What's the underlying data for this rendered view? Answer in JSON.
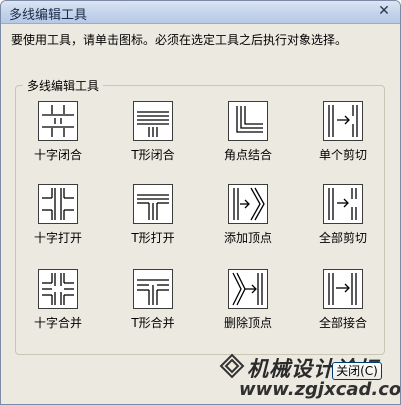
{
  "window": {
    "title": "多线编辑工具",
    "close_glyph": "✕"
  },
  "instruction": "要使用工具，请单击图标。必须在选定工具之后执行对象选择。",
  "group_label": "多线编辑工具",
  "tools": [
    {
      "label": "十字闭合",
      "icon": "cross-closed-icon"
    },
    {
      "label": "T形闭合",
      "icon": "tee-closed-icon"
    },
    {
      "label": "角点结合",
      "icon": "corner-joint-icon"
    },
    {
      "label": "单个剪切",
      "icon": "cut-single-icon"
    },
    {
      "label": "十字打开",
      "icon": "cross-open-icon"
    },
    {
      "label": "T形打开",
      "icon": "tee-open-icon"
    },
    {
      "label": "添加顶点",
      "icon": "add-vertex-icon"
    },
    {
      "label": "全部剪切",
      "icon": "cut-all-icon"
    },
    {
      "label": "十字合并",
      "icon": "cross-merged-icon"
    },
    {
      "label": "T形合并",
      "icon": "tee-merged-icon"
    },
    {
      "label": "删除顶点",
      "icon": "delete-vertex-icon"
    },
    {
      "label": "全部接合",
      "icon": "weld-all-icon"
    }
  ],
  "close_button": "关闭(C)",
  "watermark": {
    "text": "机械设计论坛",
    "url": "www.zgjxcad.com"
  }
}
